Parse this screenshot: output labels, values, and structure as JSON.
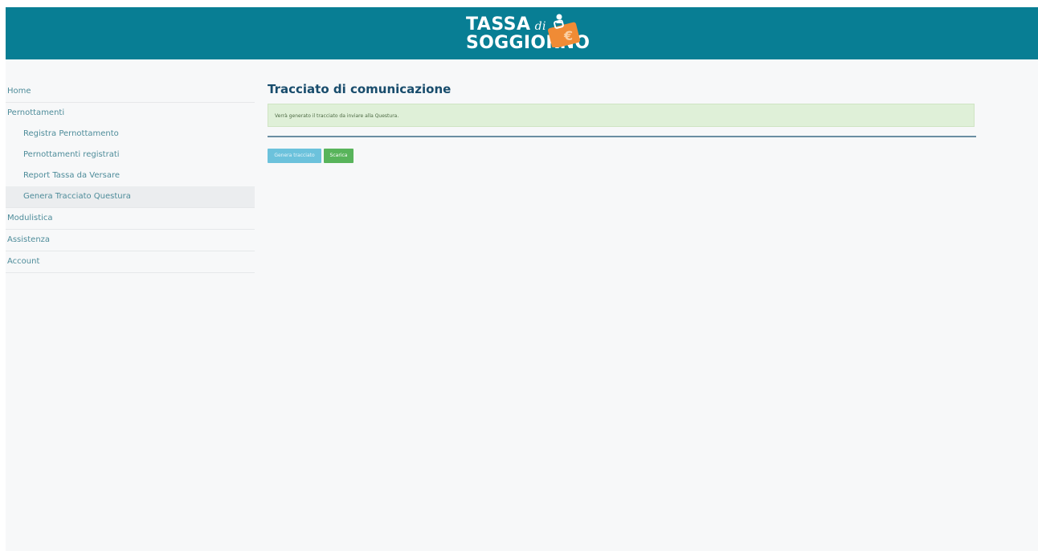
{
  "header": {
    "logo_line1": "TASSA",
    "logo_di": "di",
    "logo_line2": "SOGGIORNO",
    "euro_symbol": "€",
    "brand_color": "#087e94",
    "accent_color": "#f08b35"
  },
  "sidebar": {
    "items": [
      {
        "label": "Home"
      },
      {
        "label": "Pernottamenti"
      },
      {
        "label": "Modulistica"
      },
      {
        "label": "Assistenza"
      },
      {
        "label": "Account"
      }
    ],
    "subitems": [
      {
        "label": "Registra Pernottamento"
      },
      {
        "label": "Pernottamenti registrati"
      },
      {
        "label": "Report Tassa da Versare"
      },
      {
        "label": "Genera Tracciato Questura",
        "active": true
      }
    ]
  },
  "main": {
    "title": "Tracciato di comunicazione",
    "alert": "Verrà generato il tracciato da inviare alla Questura.",
    "buttons": {
      "generate": "Genera tracciato",
      "download": "Scarica"
    }
  }
}
